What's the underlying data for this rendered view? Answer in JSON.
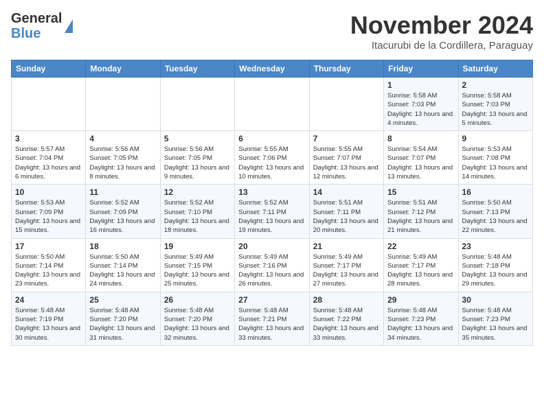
{
  "logo": {
    "line1": "General",
    "line2": "Blue"
  },
  "header": {
    "month": "November 2024",
    "location": "Itacurubi de la Cordillera, Paraguay"
  },
  "weekdays": [
    "Sunday",
    "Monday",
    "Tuesday",
    "Wednesday",
    "Thursday",
    "Friday",
    "Saturday"
  ],
  "weeks": [
    [
      {
        "day": "",
        "info": ""
      },
      {
        "day": "",
        "info": ""
      },
      {
        "day": "",
        "info": ""
      },
      {
        "day": "",
        "info": ""
      },
      {
        "day": "",
        "info": ""
      },
      {
        "day": "1",
        "info": "Sunrise: 5:58 AM\nSunset: 7:03 PM\nDaylight: 13 hours and 4 minutes."
      },
      {
        "day": "2",
        "info": "Sunrise: 5:58 AM\nSunset: 7:03 PM\nDaylight: 13 hours and 5 minutes."
      }
    ],
    [
      {
        "day": "3",
        "info": "Sunrise: 5:57 AM\nSunset: 7:04 PM\nDaylight: 13 hours and 6 minutes."
      },
      {
        "day": "4",
        "info": "Sunrise: 5:56 AM\nSunset: 7:05 PM\nDaylight: 13 hours and 8 minutes."
      },
      {
        "day": "5",
        "info": "Sunrise: 5:56 AM\nSunset: 7:05 PM\nDaylight: 13 hours and 9 minutes."
      },
      {
        "day": "6",
        "info": "Sunrise: 5:55 AM\nSunset: 7:06 PM\nDaylight: 13 hours and 10 minutes."
      },
      {
        "day": "7",
        "info": "Sunrise: 5:55 AM\nSunset: 7:07 PM\nDaylight: 13 hours and 12 minutes."
      },
      {
        "day": "8",
        "info": "Sunrise: 5:54 AM\nSunset: 7:07 PM\nDaylight: 13 hours and 13 minutes."
      },
      {
        "day": "9",
        "info": "Sunrise: 5:53 AM\nSunset: 7:08 PM\nDaylight: 13 hours and 14 minutes."
      }
    ],
    [
      {
        "day": "10",
        "info": "Sunrise: 5:53 AM\nSunset: 7:09 PM\nDaylight: 13 hours and 15 minutes."
      },
      {
        "day": "11",
        "info": "Sunrise: 5:52 AM\nSunset: 7:09 PM\nDaylight: 13 hours and 16 minutes."
      },
      {
        "day": "12",
        "info": "Sunrise: 5:52 AM\nSunset: 7:10 PM\nDaylight: 13 hours and 18 minutes."
      },
      {
        "day": "13",
        "info": "Sunrise: 5:52 AM\nSunset: 7:11 PM\nDaylight: 13 hours and 19 minutes."
      },
      {
        "day": "14",
        "info": "Sunrise: 5:51 AM\nSunset: 7:11 PM\nDaylight: 13 hours and 20 minutes."
      },
      {
        "day": "15",
        "info": "Sunrise: 5:51 AM\nSunset: 7:12 PM\nDaylight: 13 hours and 21 minutes."
      },
      {
        "day": "16",
        "info": "Sunrise: 5:50 AM\nSunset: 7:13 PM\nDaylight: 13 hours and 22 minutes."
      }
    ],
    [
      {
        "day": "17",
        "info": "Sunrise: 5:50 AM\nSunset: 7:14 PM\nDaylight: 13 hours and 23 minutes."
      },
      {
        "day": "18",
        "info": "Sunrise: 5:50 AM\nSunset: 7:14 PM\nDaylight: 13 hours and 24 minutes."
      },
      {
        "day": "19",
        "info": "Sunrise: 5:49 AM\nSunset: 7:15 PM\nDaylight: 13 hours and 25 minutes."
      },
      {
        "day": "20",
        "info": "Sunrise: 5:49 AM\nSunset: 7:16 PM\nDaylight: 13 hours and 26 minutes."
      },
      {
        "day": "21",
        "info": "Sunrise: 5:49 AM\nSunset: 7:17 PM\nDaylight: 13 hours and 27 minutes."
      },
      {
        "day": "22",
        "info": "Sunrise: 5:49 AM\nSunset: 7:17 PM\nDaylight: 13 hours and 28 minutes."
      },
      {
        "day": "23",
        "info": "Sunrise: 5:48 AM\nSunset: 7:18 PM\nDaylight: 13 hours and 29 minutes."
      }
    ],
    [
      {
        "day": "24",
        "info": "Sunrise: 5:48 AM\nSunset: 7:19 PM\nDaylight: 13 hours and 30 minutes."
      },
      {
        "day": "25",
        "info": "Sunrise: 5:48 AM\nSunset: 7:20 PM\nDaylight: 13 hours and 31 minutes."
      },
      {
        "day": "26",
        "info": "Sunrise: 5:48 AM\nSunset: 7:20 PM\nDaylight: 13 hours and 32 minutes."
      },
      {
        "day": "27",
        "info": "Sunrise: 5:48 AM\nSunset: 7:21 PM\nDaylight: 13 hours and 33 minutes."
      },
      {
        "day": "28",
        "info": "Sunrise: 5:48 AM\nSunset: 7:22 PM\nDaylight: 13 hours and 33 minutes."
      },
      {
        "day": "29",
        "info": "Sunrise: 5:48 AM\nSunset: 7:23 PM\nDaylight: 13 hours and 34 minutes."
      },
      {
        "day": "30",
        "info": "Sunrise: 5:48 AM\nSunset: 7:23 PM\nDaylight: 13 hours and 35 minutes."
      }
    ]
  ]
}
